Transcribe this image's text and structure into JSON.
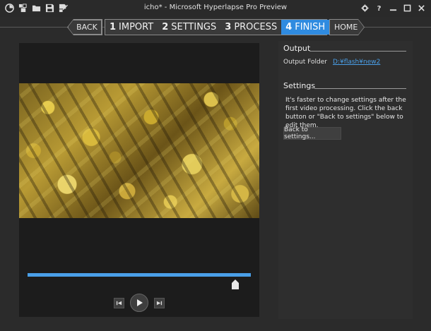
{
  "window": {
    "title": "icho* - Microsoft Hyperlapse Pro Preview",
    "toolbar_icons": [
      "app-logo-icon",
      "new-project-icon",
      "open-folder-icon",
      "save-icon",
      "save-as-icon"
    ],
    "controls": [
      "settings-gear-icon",
      "help-icon",
      "minimize-icon",
      "maximize-icon",
      "close-icon"
    ]
  },
  "nav": {
    "back_label": "BACK",
    "home_label": "HOME",
    "steps": [
      {
        "num": "1",
        "label": "IMPORT"
      },
      {
        "num": "2",
        "label": "SETTINGS"
      },
      {
        "num": "3",
        "label": "PROCESS"
      },
      {
        "num": "4",
        "label": "FINISH"
      }
    ],
    "active_step": 4
  },
  "player": {
    "progress": 1.0,
    "scrub_position": 0.93
  },
  "output": {
    "title": "Output",
    "folder_label": "Output Folder",
    "folder_path": "D:¥flash¥new2"
  },
  "settings": {
    "title": "Settings",
    "description": "It's faster to change settings after the first video processing. Click the back button or \"Back to settings\" below to edit them.",
    "back_button": "Back to settings..."
  },
  "colors": {
    "accent": "#2f8be0",
    "progress": "#4a9fe8",
    "link": "#4a9fe8"
  }
}
